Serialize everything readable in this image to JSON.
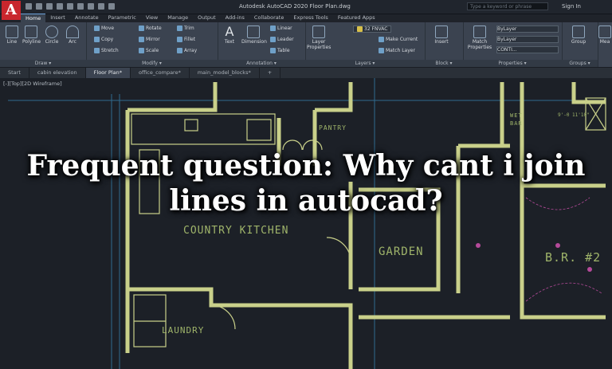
{
  "window": {
    "title": "Autodesk AutoCAD 2020    Floor Plan.dwg",
    "logo": "A",
    "search_placeholder": "Type a keyword or phrase",
    "signin": "Sign In"
  },
  "menu": [
    "Home",
    "Insert",
    "Annotate",
    "Parametric",
    "View",
    "Manage",
    "Output",
    "Add-ins",
    "Collaborate",
    "Express Tools",
    "Featured Apps"
  ],
  "ribbon": {
    "draw": {
      "title": "Draw ▾",
      "tools": [
        "Line",
        "Polyline",
        "Circle",
        "Arc"
      ]
    },
    "modify": {
      "title": "Modify ▾",
      "items": [
        "Move",
        "Rotate",
        "Trim",
        "Copy",
        "Mirror",
        "Fillet",
        "Stretch",
        "Scale",
        "Array"
      ]
    },
    "annotation": {
      "title": "Annotation ▾",
      "tools": [
        "Text",
        "Dimension"
      ],
      "items": [
        "Linear",
        "Leader",
        "Table"
      ]
    },
    "layers": {
      "title": "Layers ▾",
      "tool": "Layer Properties",
      "current": "32 FNVAC",
      "items": [
        "Make Current",
        "Match Layer"
      ]
    },
    "block": {
      "title": "Block ▾",
      "tool": "Insert"
    },
    "properties": {
      "title": "Properties ▾",
      "tool": "Match Properties",
      "values": [
        "ByLayer",
        "ByLayer",
        "CONTI..."
      ]
    },
    "groups": {
      "title": "Groups ▾",
      "tool": "Group"
    },
    "utilities": {
      "tool": "Mea"
    }
  },
  "tabs": [
    "Start",
    "cabin elevation",
    "Floor Plan*",
    "office_compare*",
    "main_model_blocks*"
  ],
  "viewport_label": "[-][Top][2D Wireframe]",
  "rooms": {
    "kitchen": "COUNTRY KITCHEN",
    "garden": "GARDEN",
    "laundry": "LAUNDRY",
    "pantry": "PANTRY",
    "bedroom": "B.R. #2",
    "wetbar_1": "WET",
    "wetbar_2": "BAR",
    "dim_note": "9'-0 11'10\""
  },
  "headline": {
    "line1": "Frequent question: Why cant i join",
    "line2": "lines in autocad?"
  },
  "colors": {
    "wall": "#c9d08a",
    "room_text": "#9fb46a",
    "dim_lines": "#2f6a8f",
    "furniture": "#8f9a5a"
  }
}
